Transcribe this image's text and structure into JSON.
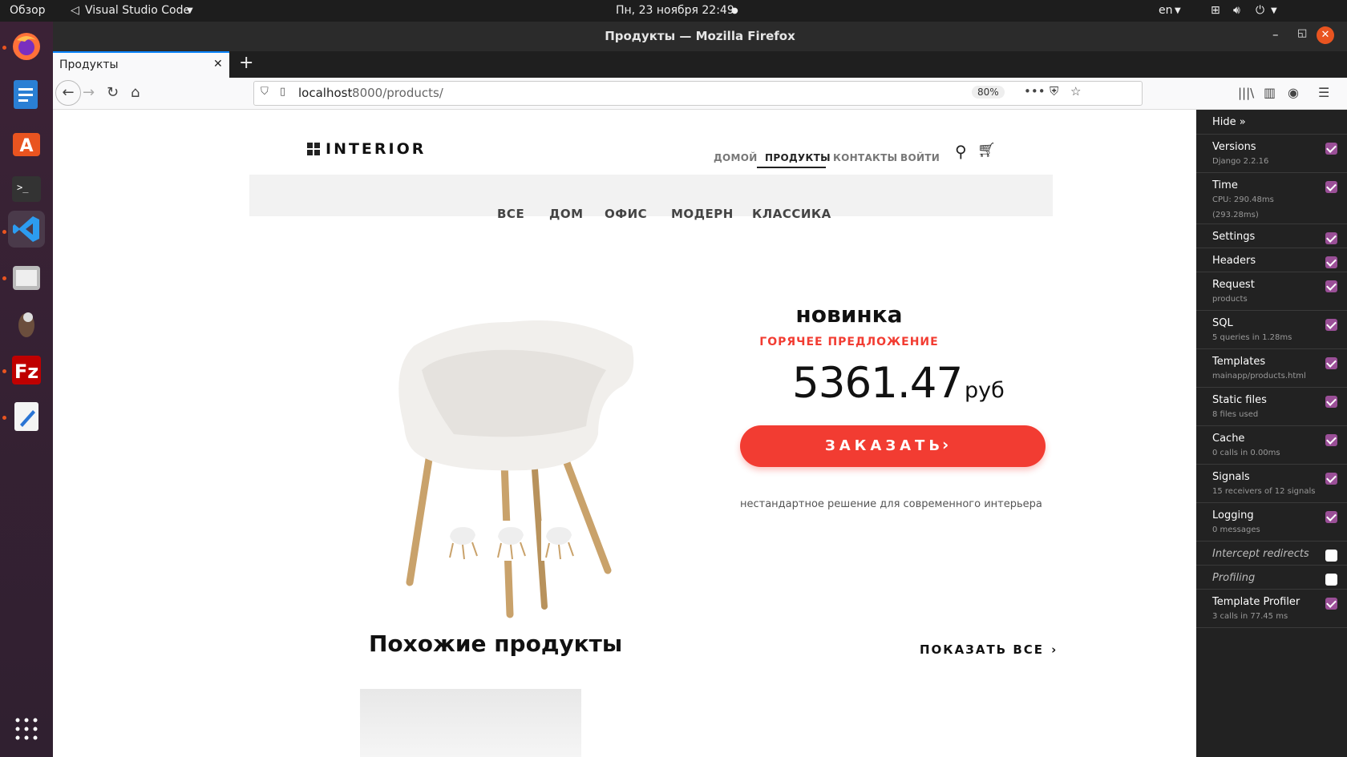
{
  "system": {
    "activities": "Обзор",
    "app_menu": "Visual Studio Code",
    "clock": "Пн, 23 ноября  22:49",
    "lang": "en"
  },
  "window": {
    "title": "Продукты — Mozilla Firefox"
  },
  "tab": {
    "label": "Продукты"
  },
  "url": {
    "host": "localhost",
    "path": ":8000/products/",
    "zoom": "80%"
  },
  "site": {
    "logo": "INTERIOR",
    "nav": [
      "ДОМОЙ",
      "ПРОДУКТЫ",
      "КОНТАКТЫ",
      "ВОЙТИ"
    ],
    "categories": [
      "ВСЕ",
      "ДОМ",
      "ОФИС",
      "МОДЕРН",
      "КЛАССИКА"
    ],
    "product": {
      "title": "новинка",
      "hot": "ГОРЯЧЕЕ ПРЕДЛОЖЕНИЕ",
      "price": "5361.47",
      "currency": "руб",
      "order": "ЗАКАЗАТЬ",
      "description": "нестандартное решение для современного интерьера"
    },
    "related_title": "Похожие продукты",
    "show_all": "ПОКАЗАТЬ ВСЕ"
  },
  "toolbar": {
    "hide": "Hide »",
    "panels": [
      {
        "name": "Versions",
        "sub": "Django 2.2.16",
        "on": true
      },
      {
        "name": "Time",
        "sub": "CPU: 290.48ms",
        "sub2": "(293.28ms)",
        "on": true
      },
      {
        "name": "Settings",
        "sub": "",
        "on": true
      },
      {
        "name": "Headers",
        "sub": "",
        "on": true
      },
      {
        "name": "Request",
        "sub": "products",
        "on": true
      },
      {
        "name": "SQL",
        "sub": "5 queries in 1.28ms",
        "on": true
      },
      {
        "name": "Templates",
        "sub": "mainapp/products.html",
        "on": true
      },
      {
        "name": "Static files",
        "sub": "8 files used",
        "on": true
      },
      {
        "name": "Cache",
        "sub": "0 calls in 0.00ms",
        "on": true
      },
      {
        "name": "Signals",
        "sub": "15 receivers of 12 signals",
        "on": true
      },
      {
        "name": "Logging",
        "sub": "0 messages",
        "on": true
      },
      {
        "name": "Intercept redirects",
        "sub": "",
        "on": false
      },
      {
        "name": "Profiling",
        "sub": "",
        "on": false
      },
      {
        "name": "Template Profiler",
        "sub": "3 calls in 77.45 ms",
        "on": true
      }
    ]
  },
  "colors": {
    "accent": "#f23c32",
    "toolbar_bg": "#222222",
    "checkbox": "#9a4f97",
    "tab_accent": "#0a84ff"
  }
}
